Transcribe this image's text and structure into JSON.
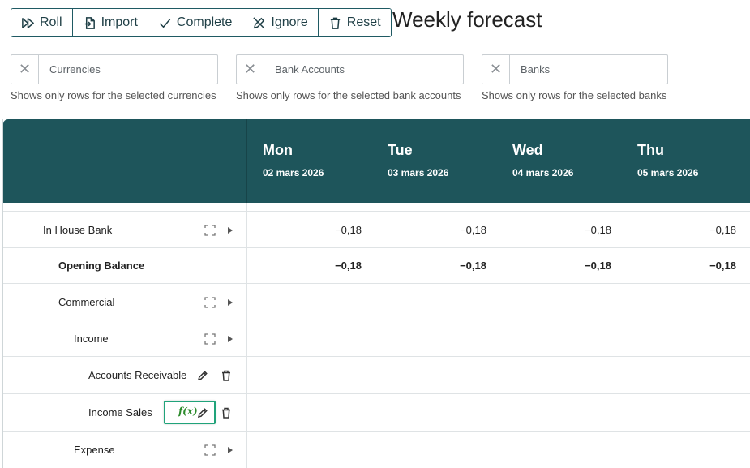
{
  "toolbar": {
    "roll_label": "Roll",
    "import_label": "Import",
    "complete_label": "Complete",
    "ignore_label": "Ignore",
    "reset_label": "Reset"
  },
  "page_title": "Weekly forecast",
  "filters": [
    {
      "placeholder": "Currencies",
      "help": "Shows only rows for the selected currencies",
      "clear_icon": "✕"
    },
    {
      "placeholder": "Bank Accounts",
      "help": "Shows only rows for the selected bank accounts",
      "clear_icon": "✕"
    },
    {
      "placeholder": "Banks",
      "help": "Shows only rows for the selected banks",
      "clear_icon": "✕"
    }
  ],
  "columns": [
    {
      "day": "Mon",
      "date": "02 mars 2026"
    },
    {
      "day": "Tue",
      "date": "03 mars 2026"
    },
    {
      "day": "Wed",
      "date": "04 mars 2026"
    },
    {
      "day": "Thu",
      "date": "05 mars 2026"
    }
  ],
  "rows": [
    {
      "label": "In House Bank",
      "values": [
        "−0,18",
        "−0,18",
        "−0,18",
        "−0,18"
      ]
    },
    {
      "label": "Opening Balance",
      "values": [
        "−0,18",
        "−0,18",
        "−0,18",
        "−0,18"
      ]
    },
    {
      "label": "Commercial"
    },
    {
      "label": "Income"
    },
    {
      "label": "Accounts Receivable"
    },
    {
      "label": "Income Sales",
      "formula_label": "f(x)"
    },
    {
      "label": "Expense"
    }
  ],
  "colors": {
    "header_bg": "#1e555b",
    "toolbar_border": "#1f5a63",
    "highlight": "#20a37a",
    "formula": "#2b8a2b"
  }
}
